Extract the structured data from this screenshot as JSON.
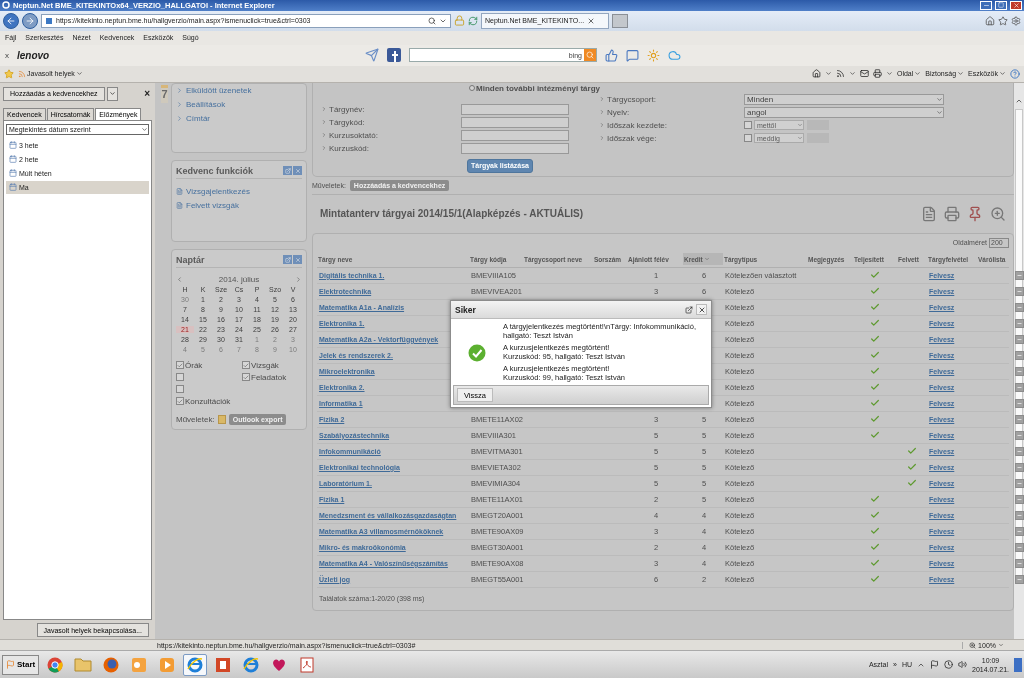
{
  "window": {
    "title": "Neptun.Net BME_KITEKINTOx64_VERZIO_HALLGATOI - Internet Explorer"
  },
  "address_bar": {
    "url": "https://kitekinto.neptun.bme.hu/hallgverzio/main.aspx?ismenuclick=true&ctrl=0303"
  },
  "browser_tabs": [
    {
      "label": "Neptun.Net BME_KITEKINTO...",
      "selected": true
    }
  ],
  "menu": [
    "Fájl",
    "Szerkesztés",
    "Nézet",
    "Kedvencek",
    "Eszközök",
    "Súgó"
  ],
  "lenovo_toolbar": {
    "close": "x",
    "logo": "lenovo",
    "search_brand": "bing"
  },
  "favorites_bar": {
    "suggested": "Javasolt helyek",
    "commands": [
      "Oldal",
      "Biztonság",
      "Eszközök"
    ]
  },
  "history_panel": {
    "add_button": "Hozzáadás a kedvencekhez",
    "close": "×",
    "tabs": [
      {
        "label": "Kedvencek",
        "selected": false
      },
      {
        "label": "Hírcsatornák",
        "selected": false
      },
      {
        "label": "Előzmények",
        "selected": true
      }
    ],
    "view": "Megtekintés dátum szerint",
    "items": [
      {
        "label": "3 hete",
        "selected": false
      },
      {
        "label": "2 hete",
        "selected": false
      },
      {
        "label": "Múlt héten",
        "selected": false
      },
      {
        "label": "Ma",
        "selected": true
      }
    ],
    "footer_button": "Javasolt helyek bekapcsolása..."
  },
  "neptun_side": {
    "badge": "7",
    "menu": [
      "Elküldött üzenetek",
      "Beállítások",
      "Címtár"
    ],
    "favorites": {
      "title": "Kedvenc funkciók",
      "items": [
        "Vizsgajelentkezés",
        "Felvett vizsgák"
      ]
    },
    "calendar": {
      "title": "Naptár",
      "month": "2014. július",
      "weekdays": [
        "H",
        "K",
        "Sze",
        "Cs",
        "P",
        "Szo",
        "V"
      ],
      "weeks": [
        [
          {
            "day": "30",
            "other_month": true,
            "today": false
          },
          {
            "day": "1",
            "other_month": false,
            "today": false
          },
          {
            "day": "2",
            "other_month": false,
            "today": false
          },
          {
            "day": "3",
            "other_month": false,
            "today": false
          },
          {
            "day": "4",
            "other_month": false,
            "today": false
          },
          {
            "day": "5",
            "other_month": false,
            "today": false
          },
          {
            "day": "6",
            "other_month": false,
            "today": false
          }
        ],
        [
          {
            "day": "7",
            "other_month": false,
            "today": false
          },
          {
            "day": "8",
            "other_month": false,
            "today": false
          },
          {
            "day": "9",
            "other_month": false,
            "today": false
          },
          {
            "day": "10",
            "other_month": false,
            "today": false
          },
          {
            "day": "11",
            "other_month": false,
            "today": false
          },
          {
            "day": "12",
            "other_month": false,
            "today": false
          },
          {
            "day": "13",
            "other_month": false,
            "today": false
          }
        ],
        [
          {
            "day": "14",
            "other_month": false,
            "today": false
          },
          {
            "day": "15",
            "other_month": false,
            "today": false
          },
          {
            "day": "16",
            "other_month": false,
            "today": false
          },
          {
            "day": "17",
            "other_month": false,
            "today": false
          },
          {
            "day": "18",
            "other_month": false,
            "today": false
          },
          {
            "day": "19",
            "other_month": false,
            "today": false
          },
          {
            "day": "20",
            "other_month": false,
            "today": false
          }
        ],
        [
          {
            "day": "21",
            "other_month": false,
            "today": true
          },
          {
            "day": "22",
            "other_month": false,
            "today": false
          },
          {
            "day": "23",
            "other_month": false,
            "today": false
          },
          {
            "day": "24",
            "other_month": false,
            "today": false
          },
          {
            "day": "25",
            "other_month": false,
            "today": false
          },
          {
            "day": "26",
            "other_month": false,
            "today": false
          },
          {
            "day": "27",
            "other_month": false,
            "today": false
          }
        ],
        [
          {
            "day": "28",
            "other_month": false,
            "today": false
          },
          {
            "day": "29",
            "other_month": false,
            "today": false
          },
          {
            "day": "30",
            "other_month": false,
            "today": false
          },
          {
            "day": "31",
            "other_month": false,
            "today": false
          },
          {
            "day": "1",
            "other_month": true,
            "today": false
          },
          {
            "day": "2",
            "other_month": true,
            "today": false
          },
          {
            "day": "3",
            "other_month": true,
            "today": false
          }
        ],
        [
          {
            "day": "4",
            "other_month": true,
            "today": false
          },
          {
            "day": "5",
            "other_month": true,
            "today": false
          },
          {
            "day": "6",
            "other_month": true,
            "today": false
          },
          {
            "day": "7",
            "other_month": true,
            "today": false
          },
          {
            "day": "8",
            "other_month": true,
            "today": false
          },
          {
            "day": "9",
            "other_month": true,
            "today": false
          },
          {
            "day": "10",
            "other_month": true,
            "today": false
          }
        ]
      ],
      "filters_left": [
        {
          "label": "Órák",
          "checked": true
        },
        {
          "checked": false
        },
        {
          "checked": false
        },
        {
          "label": "Konzultációk",
          "checked": true
        }
      ],
      "filters_right": [
        {
          "label": "Vizsgák",
          "checked": true
        },
        {
          "label": "Feladatok",
          "checked": true
        }
      ],
      "actions_label": "Műveletek:",
      "export_button": "Outlook export"
    }
  },
  "search_form": {
    "radio": {
      "label": "Minden további intézményi tárgy",
      "selected": false
    },
    "left_fields": [
      {
        "label": "Tárgynév:"
      },
      {
        "label": "Tárgykód:"
      },
      {
        "label": "Kurzusoktató:"
      },
      {
        "label": "Kurzuskód:"
      }
    ],
    "right_fields": [
      {
        "label": "Tárgycsoport:",
        "kind": "select",
        "value": "Minden"
      },
      {
        "label": "Nyelv:",
        "kind": "select",
        "value": "angol"
      },
      {
        "label": "Időszak kezdete:",
        "kind": "date",
        "placeholder": "mettől",
        "checked": false
      },
      {
        "label": "Időszak vége:",
        "kind": "date",
        "placeholder": "meddig",
        "checked": false
      }
    ],
    "submit": "Tárgyak listázása"
  },
  "actions": {
    "label": "Műveletek:",
    "button": "Hozzáadás a kedvencekhez"
  },
  "subjects": {
    "title": "Mintatanterv tárgyai 2014/15/1(Alapképzés - AKTUÁLIS)",
    "page_size_label": "Oldalméret",
    "page_size": "200",
    "columns": [
      {
        "label": "Tárgy neve",
        "sorted": false
      },
      {
        "label": "Tárgy kódja",
        "sorted": false
      },
      {
        "label": "Tárgycsoport neve",
        "sorted": false
      },
      {
        "label": "Sorszám",
        "sorted": false
      },
      {
        "label": "Ajánlott félév",
        "sorted": false
      },
      {
        "label": "Kredit",
        "sorted": true
      },
      {
        "label": "Tárgytípus",
        "sorted": false
      },
      {
        "label": "Megjegyzés",
        "sorted": false
      },
      {
        "label": "Teljesített",
        "sorted": false
      },
      {
        "label": "Felvett",
        "sorted": false
      },
      {
        "label": "Tárgyfelvétel",
        "sorted": false
      },
      {
        "label": "Várólista",
        "sorted": false
      }
    ],
    "rows": [
      {
        "name": "Digitális technika 1.",
        "code": "BMEVIIIA105",
        "semester": "1",
        "credit": "6",
        "type": "Kötelezően választott",
        "completed": true,
        "enrolled": false,
        "action": "Felvesz"
      },
      {
        "name": "Elektrotechnika",
        "code": "BMEVIVEA201",
        "semester": "3",
        "credit": "6",
        "type": "Kötelező",
        "completed": true,
        "enrolled": false,
        "action": "Felvesz"
      },
      {
        "name": "Matematika A1a - Analízis",
        "type": "Kötelező",
        "completed": true,
        "enrolled": false,
        "action": "Felvesz"
      },
      {
        "name": "Elektronika 1.",
        "type": "Kötelező",
        "completed": true,
        "enrolled": false,
        "action": "Felvesz"
      },
      {
        "name": "Matematika A2a - Vektorfüggvények",
        "type": "Kötelező",
        "completed": true,
        "enrolled": false,
        "action": "Felvesz"
      },
      {
        "name": "Jelek és rendszerek 2.",
        "type": "Kötelező",
        "completed": true,
        "enrolled": false,
        "action": "Felvesz"
      },
      {
        "name": "Mikroelektronika",
        "type": "Kötelező",
        "completed": true,
        "enrolled": false,
        "action": "Felvesz"
      },
      {
        "name": "Elektronika 2.",
        "type": "Kötelező",
        "completed": true,
        "enrolled": false,
        "action": "Felvesz"
      },
      {
        "name": "Informatika 1",
        "type": "Kötelező",
        "completed": true,
        "enrolled": false,
        "action": "Felvesz"
      },
      {
        "name": "Fizika 2",
        "code": "BMETE11AX02",
        "semester": "3",
        "credit": "5",
        "type": "Kötelező",
        "completed": true,
        "enrolled": false,
        "action": "Felvesz"
      },
      {
        "name": "Szabályozástechnika",
        "code": "BMEVIIIA301",
        "semester": "5",
        "credit": "5",
        "type": "Kötelező",
        "completed": true,
        "enrolled": false,
        "action": "Felvesz"
      },
      {
        "name": "Infokommunikáció",
        "code": "BMEVITMA301",
        "semester": "5",
        "credit": "5",
        "type": "Kötelező",
        "completed": false,
        "enrolled": true,
        "action": "Felvesz"
      },
      {
        "name": "Elektronikai technológia",
        "code": "BMEVIETA302",
        "semester": "5",
        "credit": "5",
        "type": "Kötelező",
        "completed": false,
        "enrolled": true,
        "action": "Felvesz"
      },
      {
        "name": "Laboratórium 1.",
        "code": "BMEVIMIA304",
        "semester": "5",
        "credit": "5",
        "type": "Kötelező",
        "completed": false,
        "enrolled": true,
        "action": "Felvesz"
      },
      {
        "name": "Fizika 1",
        "code": "BMETE11AX01",
        "semester": "2",
        "credit": "5",
        "type": "Kötelező",
        "completed": true,
        "enrolled": false,
        "action": "Felvesz"
      },
      {
        "name": "Menedzsment és vállalkozásgazdaságtan",
        "code": "BMEGT20A001",
        "semester": "4",
        "credit": "4",
        "type": "Kötelező",
        "completed": true,
        "enrolled": false,
        "action": "Felvesz"
      },
      {
        "name": "Matematika A3 villamosmérnököknek",
        "code": "BMETE90AX09",
        "semester": "3",
        "credit": "4",
        "type": "Kötelező",
        "completed": true,
        "enrolled": false,
        "action": "Felvesz"
      },
      {
        "name": "Mikro- és makroökonómia",
        "code": "BMEGT30A001",
        "semester": "2",
        "credit": "4",
        "type": "Kötelező",
        "completed": true,
        "enrolled": false,
        "action": "Felvesz"
      },
      {
        "name": "Matematika A4 - Valószínűségszámítás",
        "code": "BMETE90AX08",
        "semester": "3",
        "credit": "4",
        "type": "Kötelező",
        "completed": true,
        "enrolled": false,
        "action": "Felvesz"
      },
      {
        "name": "Üzleti jog",
        "code": "BMEGT55A001",
        "semester": "6",
        "credit": "2",
        "type": "Kötelező",
        "completed": true,
        "enrolled": false,
        "action": "Felvesz"
      }
    ],
    "footer": "Találatok száma:1-20/20 (398 ms)"
  },
  "dialog": {
    "title": "Siker",
    "messages": [
      [
        "A tárgyjelentkezés megtörtént!\\nTárgy: Infokommunikáció, hallgató: Teszt István"
      ],
      [
        "A kurzusjelentkezés megtörtént!",
        "Kurzuskód: 95, hallgató: Teszt István"
      ],
      [
        "A kurzusjelentkezés megtörtént!",
        "Kurzuskód: 99, hallgató: Teszt István"
      ]
    ],
    "button": "Vissza"
  },
  "status_bar": {
    "url": "https://kitekinto.neptun.bme.hu/hallgverzio/main.aspx?ismenuclick=true&ctrl=0303#",
    "zoom": "100%"
  },
  "taskbar": {
    "start": "Start",
    "apps": [
      {
        "kind": "chrome",
        "selected": false
      },
      {
        "kind": "folder",
        "selected": false
      },
      {
        "kind": "firefox",
        "selected": false
      },
      {
        "kind": "outlook",
        "selected": false
      },
      {
        "kind": "media",
        "selected": false
      },
      {
        "kind": "ie",
        "selected": true
      },
      {
        "kind": "powerpoint",
        "selected": false
      },
      {
        "kind": "ie",
        "selected": false
      },
      {
        "kind": "heart",
        "selected": false
      },
      {
        "kind": "pdf",
        "selected": false
      }
    ],
    "desktop": "Asztal",
    "chevron": "»",
    "language": "HU",
    "time": "10:09",
    "date": "2014.07.21."
  }
}
